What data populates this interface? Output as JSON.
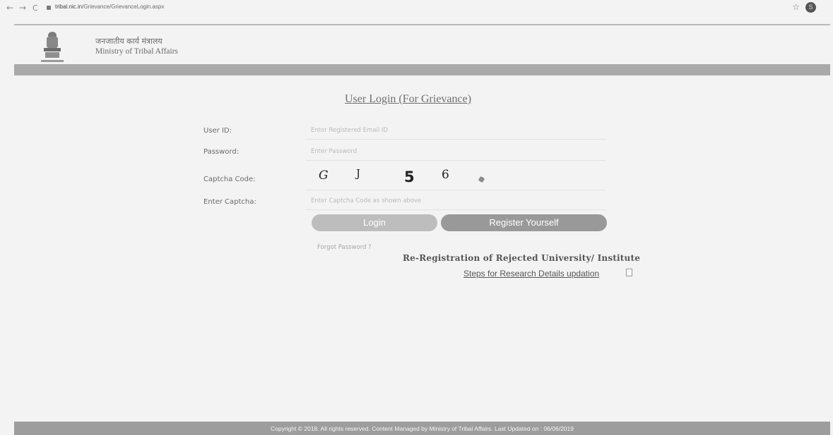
{
  "browser": {
    "back": "←",
    "forward": "→",
    "reload": "C",
    "url_host": "tribal.nic.in",
    "url_path": "/Grievance/GrievanceLogin.aspx",
    "star": "☆",
    "profile_initial": "S"
  },
  "header": {
    "hindi_title": "जनजातीय कार्य मंत्रालय",
    "ministry": "Ministry of Tribal Affairs"
  },
  "login": {
    "title": "User Login (For Grievance)",
    "user_id_label": "User ID:",
    "user_id_placeholder": "Enter Registered Email ID",
    "password_label": "Password:",
    "password_placeholder": "Enter Password",
    "captcha_label": "Captcha Code:",
    "captcha_chars": [
      "G",
      "J",
      "5",
      "6"
    ],
    "enter_captcha_label": "Enter Captcha:",
    "enter_captcha_placeholder": "Enter Captcha Code as shown above",
    "login_button": "Login",
    "register_button": "Register Yourself",
    "forgot_password": "Forgot Password ?",
    "reregistration": "Re-Registration of Rejected University/ Institute",
    "steps_link": "Steps for Research Details updation"
  },
  "footer": {
    "text": "Copyright © 2018. All rights reserved. Content Managed by Ministry of Tribal Affairs. Last Updated on : 06/06/2019"
  },
  "colors": {
    "header_band": "#a9a9a9",
    "login_button": "#bdbdbd",
    "register_button": "#999999",
    "footer": "#9d9d9d"
  }
}
